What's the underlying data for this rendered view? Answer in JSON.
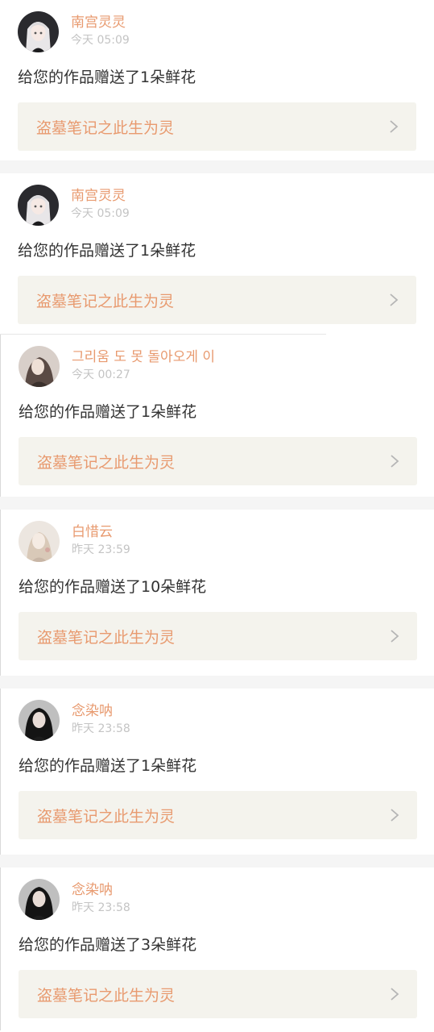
{
  "colors": {
    "accent": "#e89a6f",
    "link_bg": "#f4f3ed",
    "time": "#c4c4c4",
    "text": "#333333"
  },
  "notifications": [
    {
      "username": "南宫灵灵",
      "time": "今天 05:09",
      "message": "给您的作品赠送了1朵鲜花",
      "work_title": "盗墓笔记之此生为灵",
      "avatar_icon": "anime-girl-white-hair-icon"
    },
    {
      "username": "南宫灵灵",
      "time": "今天 05:09",
      "message": "给您的作品赠送了1朵鲜花",
      "work_title": "盗墓笔记之此生为灵",
      "avatar_icon": "anime-girl-white-hair-icon"
    },
    {
      "username": "그리움 도 못 돌아오게 이",
      "time": "今天 00:27",
      "message": "给您的作品赠送了1朵鲜花",
      "work_title": "盗墓笔记之此生为灵",
      "avatar_icon": "girl-photo-icon"
    },
    {
      "username": "白惜云",
      "time": "昨天 23:59",
      "message": "给您的作品赠送了10朵鲜花",
      "work_title": "盗墓笔记之此生为灵",
      "avatar_icon": "girl-light-photo-icon"
    },
    {
      "username": "念染呐",
      "time": "昨天 23:58",
      "message": "给您的作品赠送了1朵鲜花",
      "work_title": "盗墓笔记之此生为灵",
      "avatar_icon": "girl-dark-hair-icon"
    },
    {
      "username": "念染呐",
      "time": "昨天 23:58",
      "message": "给您的作品赠送了3朵鲜花",
      "work_title": "盗墓笔记之此生为灵",
      "avatar_icon": "girl-dark-hair-icon"
    }
  ]
}
